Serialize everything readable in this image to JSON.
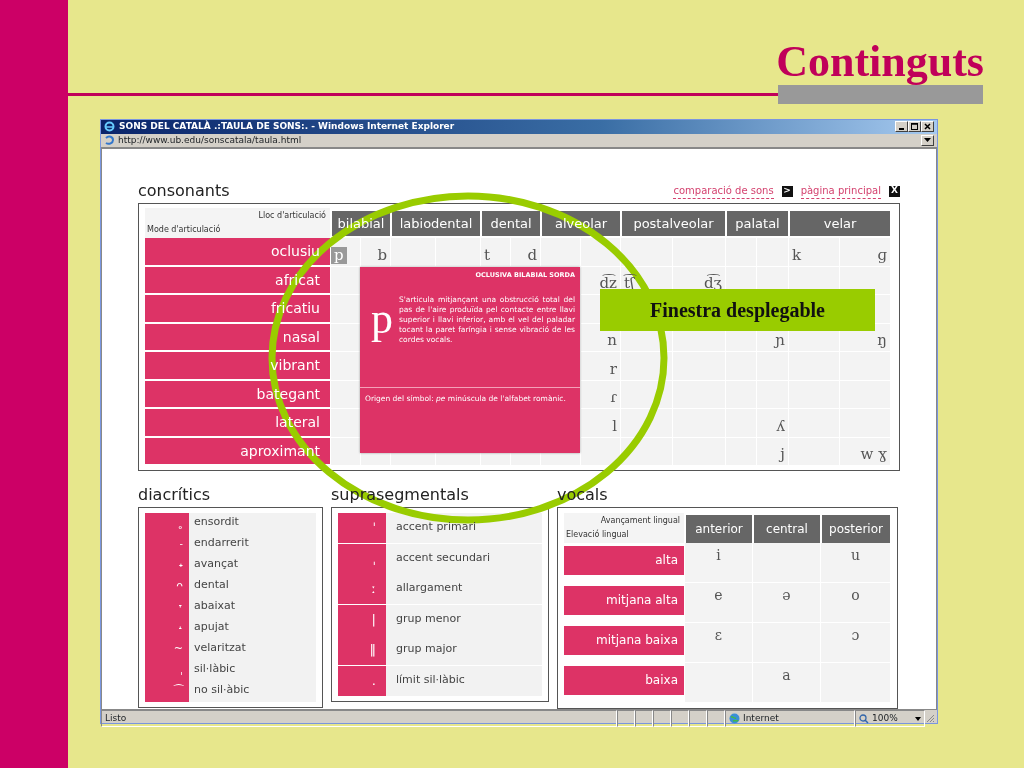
{
  "slide": {
    "title": "Continguts"
  },
  "browser": {
    "title": "SONS DEL CATALÀ .:TAULA DE SONS:. - Windows Internet Explorer",
    "address": "http://www.ub.edu/sonscatala/taula.html",
    "status": "Listo",
    "zone": "Internet",
    "zoom": "100%"
  },
  "links": [
    {
      "label": "comparació de sons",
      "key": ">"
    },
    {
      "label": "pàgina principal",
      "key": "X"
    }
  ],
  "consonants": {
    "heading": "consonants",
    "corner_top": "Lloc d'articulació",
    "corner_bottom": "Mode d'articulació",
    "places": [
      "bilabial",
      "labiodental",
      "dental",
      "alveolar",
      "postalveolar",
      "palatal",
      "velar"
    ],
    "rows": [
      {
        "manner": "oclusiu",
        "cells": [
          {
            "symbol": "p",
            "selected": true
          },
          {
            "symbol": "b",
            "selected": false
          },
          null,
          null,
          {
            "symbol": "t",
            "selected": false
          },
          {
            "symbol": "d",
            "selected": false
          },
          null,
          null,
          null,
          null,
          null,
          null,
          {
            "symbol": "k",
            "selected": false
          },
          {
            "symbol": "ɡ",
            "selected": false
          }
        ]
      },
      {
        "manner": "africat",
        "cells": [
          null,
          null,
          null,
          null,
          null,
          null,
          null,
          {
            "symbol": "d͡z",
            "selected": false
          },
          {
            "symbol": "t͡ʃ",
            "selected": false
          },
          {
            "symbol": "d͡ʒ",
            "selected": false
          },
          null,
          null,
          null,
          null
        ]
      },
      {
        "manner": "fricatiu",
        "cells": [
          null,
          null,
          null,
          null,
          null,
          null,
          null,
          null,
          null,
          null,
          null,
          null,
          null,
          null
        ]
      },
      {
        "manner": "nasal",
        "cells": [
          null,
          null,
          null,
          null,
          null,
          null,
          null,
          {
            "symbol": "n",
            "selected": false
          },
          null,
          null,
          null,
          {
            "symbol": "ɲ",
            "selected": false
          },
          null,
          {
            "symbol": "ŋ",
            "selected": false
          }
        ]
      },
      {
        "manner": "vibrant",
        "cells": [
          null,
          null,
          null,
          null,
          null,
          null,
          null,
          {
            "symbol": "r",
            "selected": false
          },
          null,
          null,
          null,
          null,
          null,
          null
        ]
      },
      {
        "manner": "bategant",
        "cells": [
          null,
          null,
          null,
          null,
          null,
          null,
          null,
          {
            "symbol": "ɾ",
            "selected": false
          },
          null,
          null,
          null,
          null,
          null,
          null
        ]
      },
      {
        "manner": "lateral",
        "cells": [
          null,
          null,
          null,
          null,
          null,
          null,
          null,
          {
            "symbol": "l",
            "selected": false
          },
          null,
          null,
          null,
          {
            "symbol": "ʎ",
            "selected": false
          },
          null,
          null
        ]
      },
      {
        "manner": "aproximant",
        "cells": [
          null,
          null,
          null,
          null,
          null,
          null,
          null,
          null,
          null,
          null,
          null,
          {
            "symbol": "j",
            "selected": false
          },
          null,
          {
            "symbol": "w ɣ",
            "selected": false
          }
        ]
      }
    ]
  },
  "popup": {
    "title": "OCLUSIVA BILABIAL SORDA",
    "symbol": "p",
    "description": "S'articula mitjançant una obstrucció total del pas de l'aire produïda pel contacte entre llavi superior i llavi inferior, amb el vel del paladar tocant la paret faríngia i sense vibració de les cordes vocals.",
    "origin": "Origen del símbol: *pe* minúscula de l'alfabet romànic."
  },
  "diacritics": {
    "heading": "diacrítics",
    "items": [
      {
        "symbol": "˳",
        "label": "ensordit"
      },
      {
        "symbol": "˗",
        "label": "endarrerit"
      },
      {
        "symbol": "˖",
        "label": "avançat"
      },
      {
        "symbol": "ᴖ",
        "label": "dental"
      },
      {
        "symbol": "˕",
        "label": "abaixat"
      },
      {
        "symbol": "˔",
        "label": "apujat"
      },
      {
        "symbol": "~",
        "label": "velaritzat"
      },
      {
        "symbol": "ˌ",
        "label": "sil·làbic"
      },
      {
        "symbol": "⁀",
        "label": "no sil·àbic"
      }
    ]
  },
  "suprasegmentals": {
    "heading": "suprasegmentals",
    "items": [
      {
        "symbol": "ˈ",
        "label": "accent primari"
      },
      {
        "symbol": "ˌ",
        "label": "accent secundari"
      },
      {
        "symbol": "ː",
        "label": "allargament"
      },
      {
        "symbol": "|",
        "label": "grup menor"
      },
      {
        "symbol": "‖",
        "label": "grup major"
      },
      {
        "symbol": ".",
        "label": "límit sil·làbic"
      }
    ]
  },
  "vowels": {
    "heading": "vocals",
    "corner_top": "Avançament lingual",
    "corner_bottom": "Elevació lingual",
    "columns": [
      "anterior",
      "central",
      "posterior"
    ],
    "rows": [
      {
        "height": "alta",
        "cells": [
          "i",
          null,
          "u"
        ]
      },
      {
        "height": "mitjana alta",
        "cells": [
          "e",
          "ə",
          "o"
        ]
      },
      {
        "height": "mitjana baixa",
        "cells": [
          "ɛ",
          null,
          "ɔ"
        ]
      },
      {
        "height": "baixa",
        "cells": [
          null,
          "a",
          null
        ]
      }
    ]
  },
  "annotation": {
    "label": "Finestra desplegable"
  }
}
